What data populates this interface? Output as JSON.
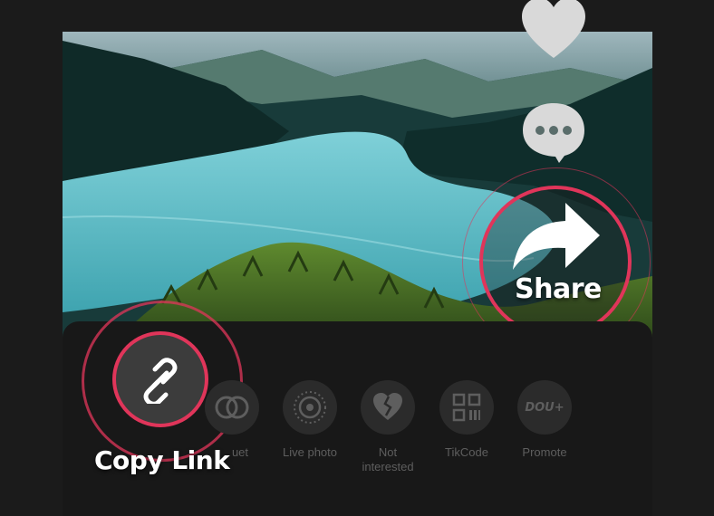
{
  "share_sheet": {
    "options": [
      {
        "label": "Copy Link",
        "icon": "link-icon"
      },
      {
        "label": "Duet",
        "icon": "duet-icon"
      },
      {
        "label": "Live photo",
        "icon": "live-photo-icon"
      },
      {
        "label": "Not interested",
        "icon": "broken-heart-icon"
      },
      {
        "label": "TikCode",
        "icon": "qr-code-icon"
      },
      {
        "label": "Promote",
        "icon": "dou-plus-icon"
      }
    ],
    "promote_badge": "DOU+",
    "visible_duet_fragment": "uet",
    "not_interested_line1": "Not",
    "not_interested_line2": "interested"
  },
  "side_actions": {
    "like_icon": "heart-icon",
    "comment_icon": "comment-bubble-icon",
    "share_icon": "share-arrow-icon"
  },
  "callouts": {
    "share": "Share",
    "copy_link": "Copy Link"
  },
  "colors": {
    "highlight_ring": "#e0355a",
    "sheet_bg": "#181818",
    "page_bg": "#1b1b1b"
  }
}
